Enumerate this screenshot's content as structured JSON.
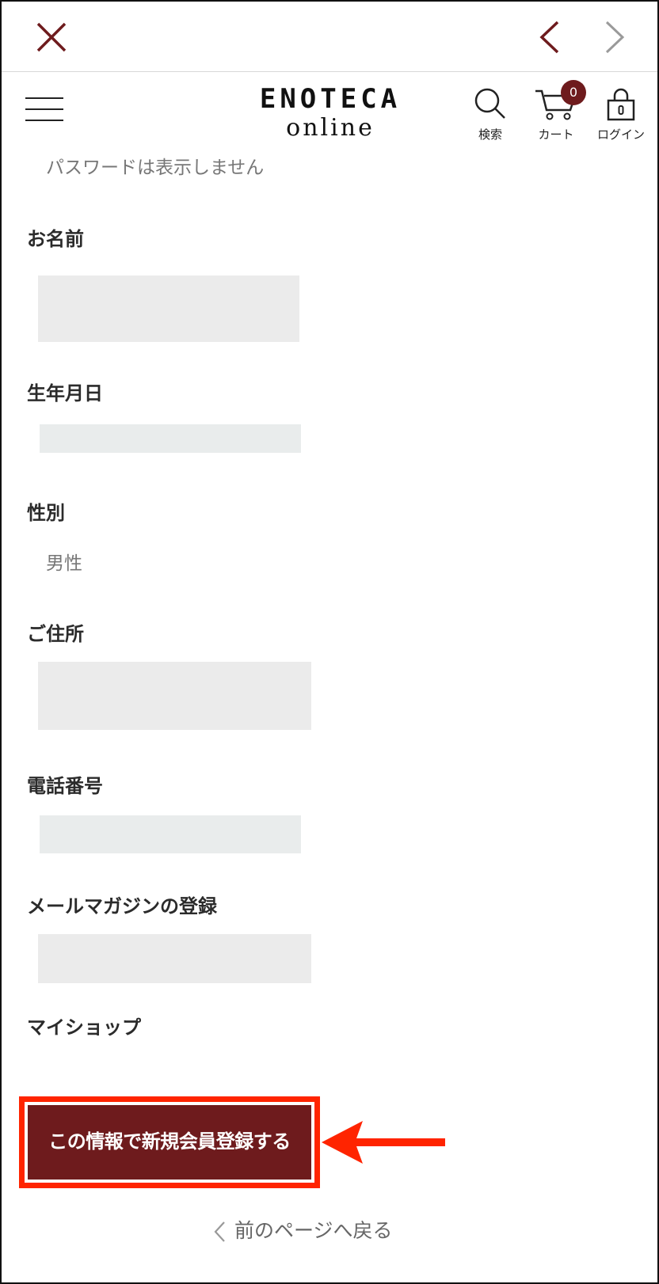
{
  "topbar": {
    "close_icon": "close-icon",
    "prev_icon": "chevron-left-icon",
    "next_icon": "chevron-right-icon"
  },
  "header": {
    "logo_line1": "ENOTECA",
    "logo_line2": "online",
    "search_label": "検索",
    "cart_label": "カート",
    "cart_count": "0",
    "login_label": "ログイン"
  },
  "form": {
    "password_note": "パスワードは表示しません",
    "name_label": "お名前",
    "birthday_label": "生年月日",
    "gender_label": "性別",
    "gender_value": "男性",
    "address_label": "ご住所",
    "phone_label": "電話番号",
    "newsletter_label": "メールマガジンの登録",
    "myshop_label": "マイショップ"
  },
  "actions": {
    "submit_label": "この情報で新規会員登録する",
    "back_label": "前のページへ戻る"
  },
  "colors": {
    "brand": "#6e1b1d",
    "highlight": "#ff2400",
    "text": "#2b2b2b",
    "muted": "#777777"
  }
}
